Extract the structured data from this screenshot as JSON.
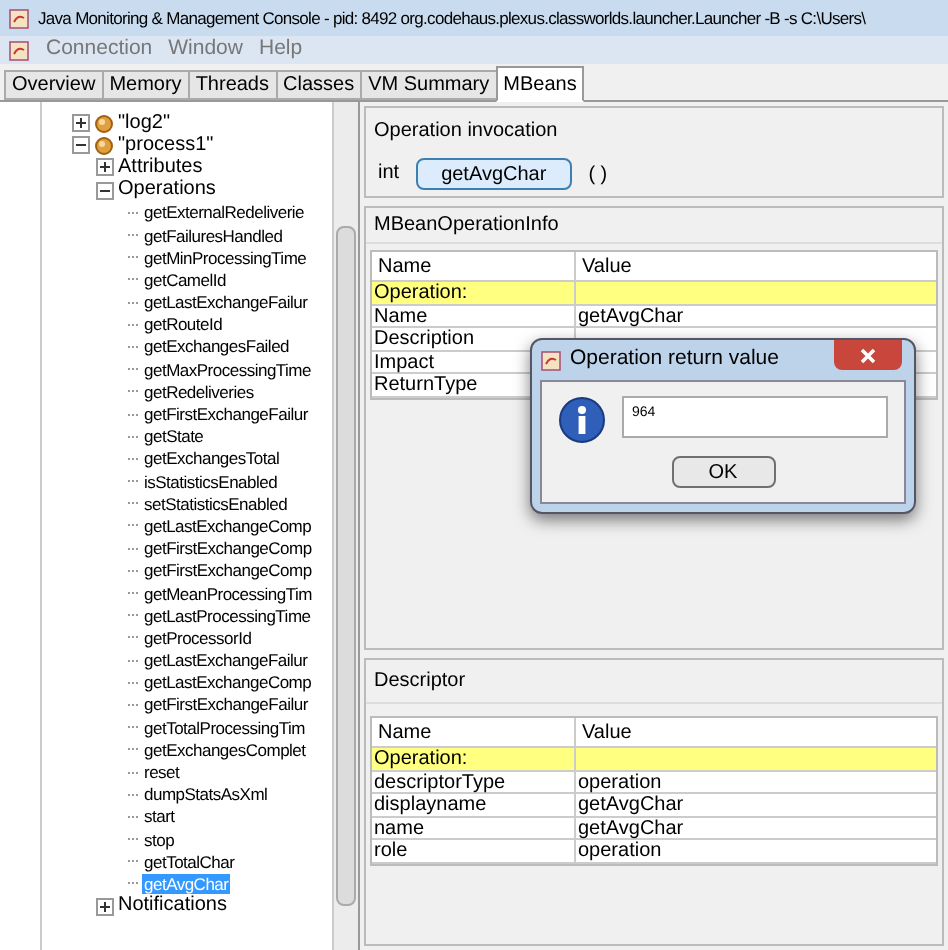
{
  "window": {
    "title": "Java Monitoring & Management Console - pid: 8492 org.codehaus.plexus.classworlds.launcher.Launcher -B -s C:\\Users\\"
  },
  "menu": [
    "Connection",
    "Window",
    "Help"
  ],
  "tabs": [
    {
      "label": "Overview",
      "selected": false
    },
    {
      "label": "Memory",
      "selected": false
    },
    {
      "label": "Threads",
      "selected": false
    },
    {
      "label": "Classes",
      "selected": false
    },
    {
      "label": "VM Summary",
      "selected": false
    },
    {
      "label": "MBeans",
      "selected": true
    }
  ],
  "tree": [
    {
      "label": "\"log2\"",
      "expanded": false
    },
    {
      "label": "\"process1\"",
      "expanded": true,
      "children": [
        {
          "label": "Attributes",
          "expanded": false
        },
        {
          "label": "Operations",
          "expanded": true,
          "children": [
            {
              "label": "getExternalRedeliverie",
              "selected": false
            },
            {
              "label": "getFailuresHandled",
              "selected": false
            },
            {
              "label": "getMinProcessingTime",
              "selected": false
            },
            {
              "label": "getCamelId",
              "selected": false
            },
            {
              "label": "getLastExchangeFailur",
              "selected": false
            },
            {
              "label": "getRouteId",
              "selected": false
            },
            {
              "label": "getExchangesFailed",
              "selected": false
            },
            {
              "label": "getMaxProcessingTime",
              "selected": false
            },
            {
              "label": "getRedeliveries",
              "selected": false
            },
            {
              "label": "getFirstExchangeFailur",
              "selected": false
            },
            {
              "label": "getState",
              "selected": false
            },
            {
              "label": "getExchangesTotal",
              "selected": false
            },
            {
              "label": "isStatisticsEnabled",
              "selected": false
            },
            {
              "label": "setStatisticsEnabled",
              "selected": false
            },
            {
              "label": "getLastExchangeComp",
              "selected": false
            },
            {
              "label": "getFirstExchangeComp",
              "selected": false
            },
            {
              "label": "getFirstExchangeComp",
              "selected": false
            },
            {
              "label": "getMeanProcessingTim",
              "selected": false
            },
            {
              "label": "getLastProcessingTime",
              "selected": false
            },
            {
              "label": "getProcessorId",
              "selected": false
            },
            {
              "label": "getLastExchangeFailur",
              "selected": false
            },
            {
              "label": "getLastExchangeComp",
              "selected": false
            },
            {
              "label": "getFirstExchangeFailur",
              "selected": false
            },
            {
              "label": "getTotalProcessingTim",
              "selected": false
            },
            {
              "label": "getExchangesComplet",
              "selected": false
            },
            {
              "label": "reset",
              "selected": false
            },
            {
              "label": "dumpStatsAsXml",
              "selected": false
            },
            {
              "label": "start",
              "selected": false
            },
            {
              "label": "stop",
              "selected": false
            },
            {
              "label": "getTotalChar",
              "selected": false
            },
            {
              "label": "getAvgChar",
              "selected": true
            }
          ]
        },
        {
          "label": "Notifications",
          "expanded": false
        }
      ]
    }
  ],
  "invocation": {
    "title": "Operation invocation",
    "return_type": "int",
    "button": "getAvgChar",
    "params": "( )"
  },
  "operation_info": {
    "title": "MBeanOperationInfo",
    "columns": [
      "Name",
      "Value"
    ],
    "rows": [
      {
        "name": "Operation:",
        "value": "",
        "kind": "section"
      },
      {
        "name": "Name",
        "value": "getAvgChar",
        "kind": "row"
      },
      {
        "name": "Description",
        "value": "",
        "kind": "row"
      },
      {
        "name": "Impact",
        "value": "",
        "kind": "row"
      },
      {
        "name": "ReturnType",
        "value": "",
        "kind": "row"
      }
    ]
  },
  "descriptor": {
    "title": "Descriptor",
    "columns": [
      "Name",
      "Value"
    ],
    "rows": [
      {
        "name": "Operation:",
        "value": "",
        "kind": "section"
      },
      {
        "name": "descriptorType",
        "value": "operation",
        "kind": "row"
      },
      {
        "name": "displayname",
        "value": "getAvgChar",
        "kind": "row"
      },
      {
        "name": "name",
        "value": "getAvgChar",
        "kind": "row"
      },
      {
        "name": "role",
        "value": "operation",
        "kind": "row"
      }
    ]
  },
  "dialog": {
    "title": "Operation return value",
    "value": "964",
    "button": "OK"
  }
}
